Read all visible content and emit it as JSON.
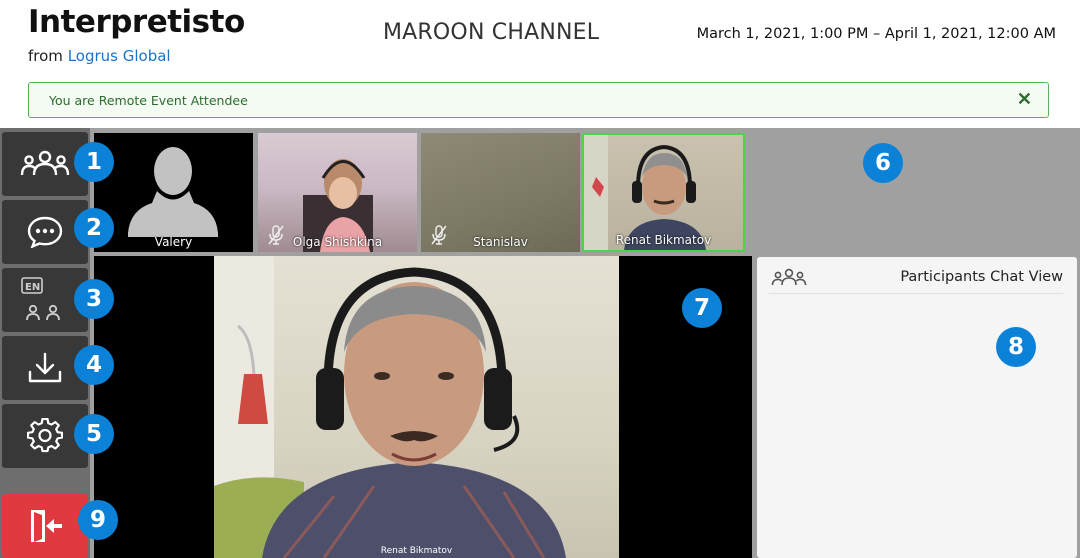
{
  "header": {
    "app_title": "Interpretisto",
    "from_prefix": "from",
    "org_link": "Logrus Global",
    "channel": "MAROON CHANNEL",
    "date_range": "March 1, 2021, 1:00 PM – April 1, 2021, 12:00 AM"
  },
  "notice": {
    "text": "You are Remote Event Attendee",
    "close_glyph": "✕"
  },
  "sidebar": {
    "items": [
      {
        "icon": "participants-icon",
        "badge": "1"
      },
      {
        "icon": "chat-bubble-icon",
        "badge": "2"
      },
      {
        "icon": "language-participants-icon",
        "lang": "EN",
        "badge": "3"
      },
      {
        "icon": "download-icon",
        "badge": "4"
      },
      {
        "icon": "gear-icon",
        "badge": "5"
      },
      {
        "icon": "exit-icon",
        "badge": "9"
      }
    ]
  },
  "thumbnails": [
    {
      "name": "Valery",
      "muted": false,
      "video": false
    },
    {
      "name": "Olga Shishkina",
      "muted": true,
      "video": true
    },
    {
      "name": "Stanislav",
      "muted": true,
      "video": true
    },
    {
      "name": "Renat Bikmatov",
      "muted": false,
      "video": true,
      "active": true
    }
  ],
  "thumb_area_badge": "6",
  "main_video": {
    "speaker": "Renat Bikmatov",
    "badge": "7"
  },
  "chat_panel": {
    "title": "Participants Chat View",
    "badge": "8"
  },
  "colors": {
    "badge": "#0b82d8",
    "sidebar_button": "#383838",
    "exit_button": "#e0393f",
    "notice_border": "#58b358",
    "active_speaker": "#4fd14f",
    "link": "#1a73c9"
  }
}
